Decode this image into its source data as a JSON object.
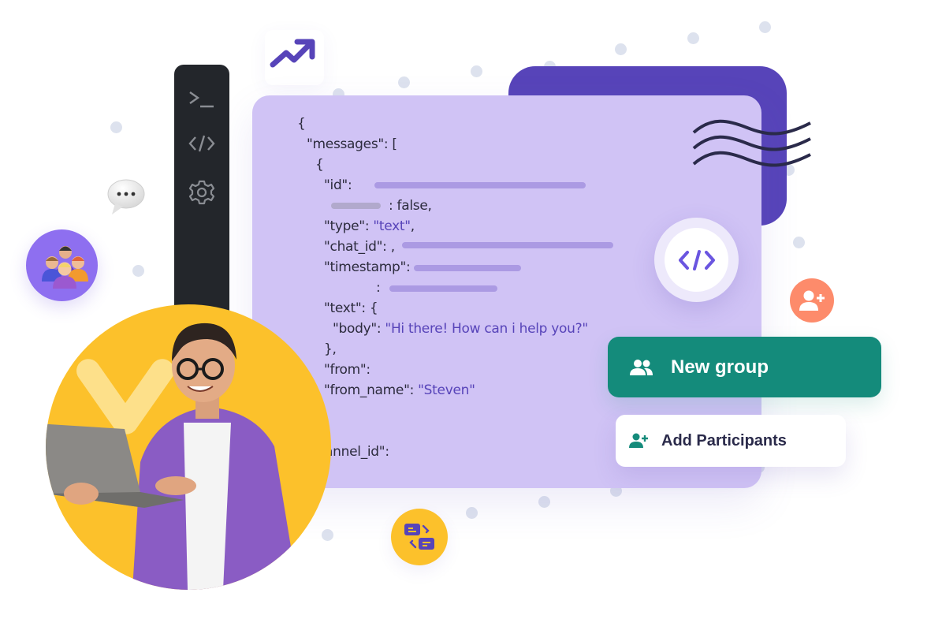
{
  "toolbar": {
    "items": [
      {
        "icon": "terminal-icon",
        "glyph": ">_"
      },
      {
        "icon": "code-icon",
        "glyph": "</>"
      },
      {
        "icon": "gear-icon",
        "glyph": "⚙"
      }
    ]
  },
  "code": {
    "lines": {
      "l1": "{",
      "l2": "\"messages\": [",
      "l3": "{",
      "l4": "\"id\":",
      "l5": ": false,",
      "l6_key": "\"type\": ",
      "l6_val": "\"text\"",
      "l6_end": ",",
      "l7": "\"chat_id\": ,",
      "l8": "\"timestamp\":",
      "l9": ":",
      "l10": "\"text\": {",
      "l11_key": "\"body\": ",
      "l11_val": "\"Hi there! How can i help you?\"",
      "l12": "},",
      "l13": "\"from\":",
      "l14_key": "\"from_name\": ",
      "l14_val": "\"Steven\"",
      "l15": "\"channel_id\":"
    }
  },
  "actions": {
    "new_group": "New group",
    "add_participants": "Add Participants"
  },
  "icons": {
    "code_badge": "code-icon",
    "orange_badge": "add-user-icon",
    "trend": "trending-up-icon",
    "chat": "chat-bubble-icon",
    "team": "team-icon",
    "swap": "swap-messages-icon"
  },
  "colors": {
    "accent_purple": "#5744b9",
    "panel_lavender": "#d0c3f5",
    "teal": "#148b7b",
    "yellow": "#fcc12b",
    "orange": "#fd8b6b",
    "toolbar_dark": "#23262b"
  }
}
